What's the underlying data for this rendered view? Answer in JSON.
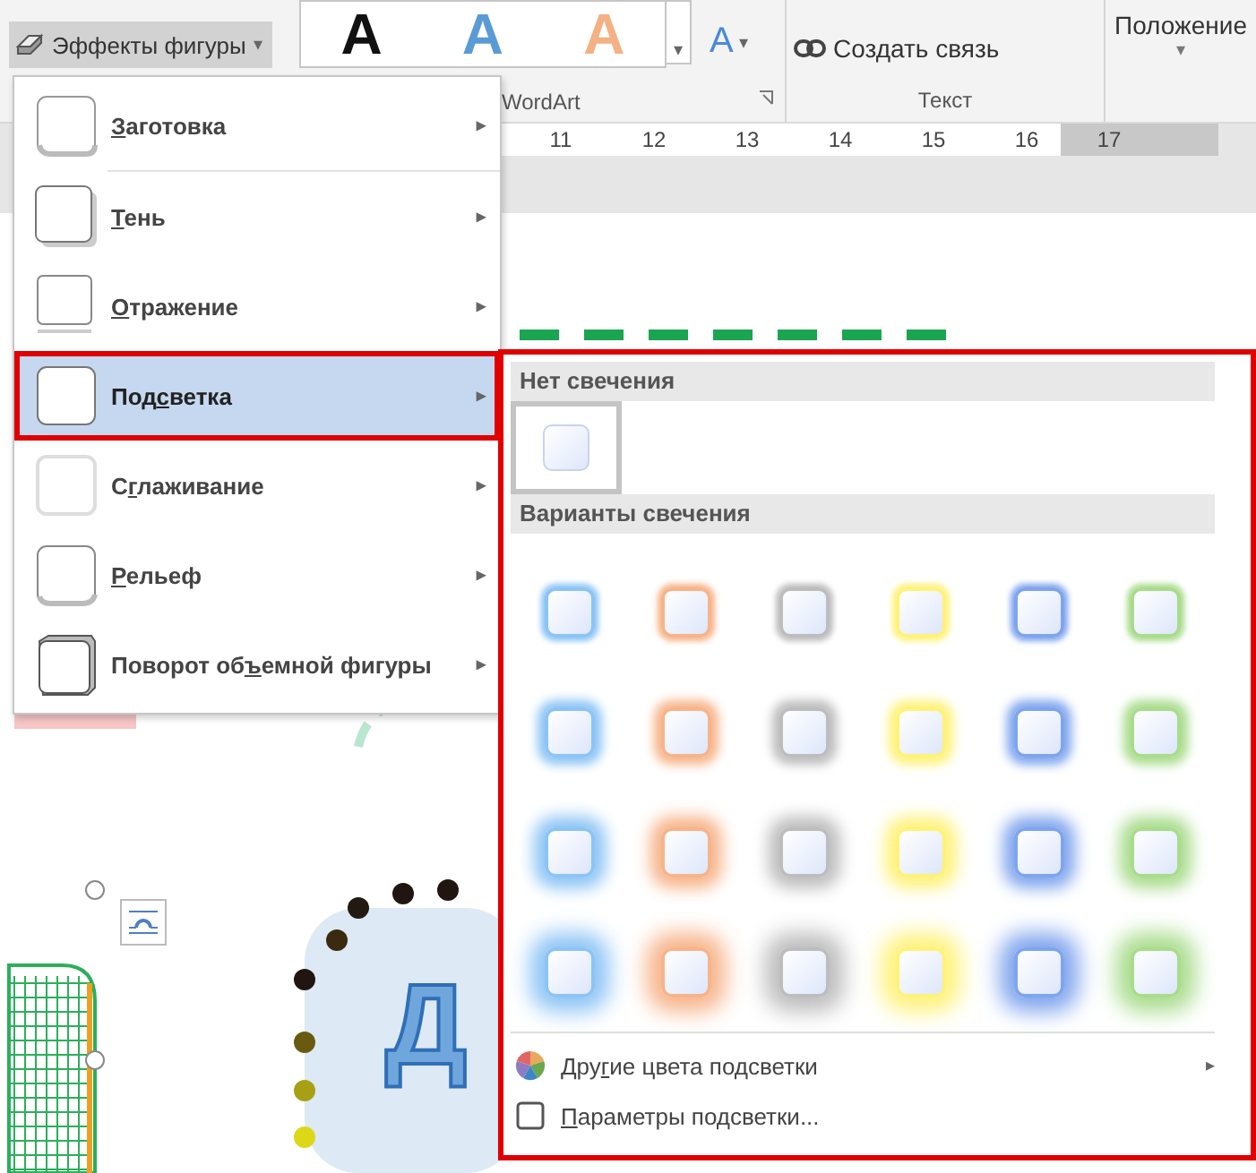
{
  "ribbon": {
    "effects_button": {
      "label": "Эффекты фигуры",
      "caret": "▾",
      "pressed": true
    },
    "wordart": {
      "styles": [
        {
          "letter": "A",
          "color": "#111111"
        },
        {
          "letter": "A",
          "color": "#5b9bd5"
        },
        {
          "letter": "A",
          "color": "#f4b183"
        }
      ],
      "more": "▾",
      "text_effects": {
        "letter": "A",
        "caret": "▾"
      },
      "label": "WordArt"
    },
    "text_group": {
      "link_button": "Создать связь",
      "label": "Текст"
    },
    "position_button": {
      "label": "Положение",
      "caret": "▾"
    }
  },
  "ruler": {
    "numbers": [
      "11",
      "12",
      "13",
      "14",
      "15",
      "16",
      "17"
    ]
  },
  "document": {
    "shape_text": "Д"
  },
  "effects_menu": {
    "items": [
      {
        "kind": "preset",
        "key": "З",
        "post": "аготовка",
        "selected": false
      },
      {
        "kind": "shadow",
        "key": "Т",
        "post": "ень",
        "selected": false
      },
      {
        "kind": "reflection",
        "key": "О",
        "post": "тражение",
        "selected": false
      },
      {
        "kind": "glow",
        "pre": "Под",
        "key": "с",
        "post": "ветка",
        "selected": true
      },
      {
        "kind": "soft",
        "pre": "С",
        "key": "г",
        "post": "лаживание",
        "selected": false
      },
      {
        "kind": "bevel",
        "key": "Р",
        "post": "ельеф",
        "selected": false
      },
      {
        "kind": "rotation",
        "pre": "Поворот об",
        "key": "ъ",
        "post": "емной фигуры",
        "selected": false
      }
    ],
    "arrow": "▸"
  },
  "glow_panel": {
    "no_glow": {
      "heading": "Нет свечения",
      "selected": true
    },
    "variants": {
      "heading": "Варианты свечения",
      "rows": [
        {
          "items": [
            {
              "color": "#8cc4f5",
              "selected": false
            },
            {
              "color": "#f7b48a",
              "selected": false
            },
            {
              "color": "#bdbdbd",
              "selected": false
            },
            {
              "color": "#fff27a",
              "selected": false
            },
            {
              "color": "#7fa5ee",
              "selected": false
            },
            {
              "color": "#a9dc8c",
              "selected": false
            }
          ]
        },
        {
          "items": [
            {
              "color": "#8cc4f5",
              "selected": false
            },
            {
              "color": "#f7b48a",
              "selected": false
            },
            {
              "color": "#bdbdbd",
              "selected": false
            },
            {
              "color": "#fff27a",
              "selected": false
            },
            {
              "color": "#7fa5ee",
              "selected": false
            },
            {
              "color": "#a9dc8c",
              "selected": false
            }
          ]
        },
        {
          "items": [
            {
              "color": "#8cc4f5",
              "selected": false
            },
            {
              "color": "#f7b48a",
              "selected": false
            },
            {
              "color": "#bdbdbd",
              "selected": false
            },
            {
              "color": "#fff27a",
              "selected": false
            },
            {
              "color": "#7fa5ee",
              "selected": false
            },
            {
              "color": "#a9dc8c",
              "selected": false
            }
          ]
        },
        {
          "items": [
            {
              "color": "#8cc4f5",
              "selected": false
            },
            {
              "color": "#f7b48a",
              "selected": false
            },
            {
              "color": "#bdbdbd",
              "selected": false
            },
            {
              "color": "#fff27a",
              "selected": false
            },
            {
              "color": "#7fa5ee",
              "selected": false
            },
            {
              "color": "#a9dc8c",
              "selected": false
            }
          ]
        }
      ]
    },
    "more_colors": {
      "pre": "Дру",
      "key": "г",
      "post": "ие цвета подсветки",
      "arrow": "▸"
    },
    "options": {
      "key": "П",
      "post": "араметры подсветки..."
    }
  }
}
